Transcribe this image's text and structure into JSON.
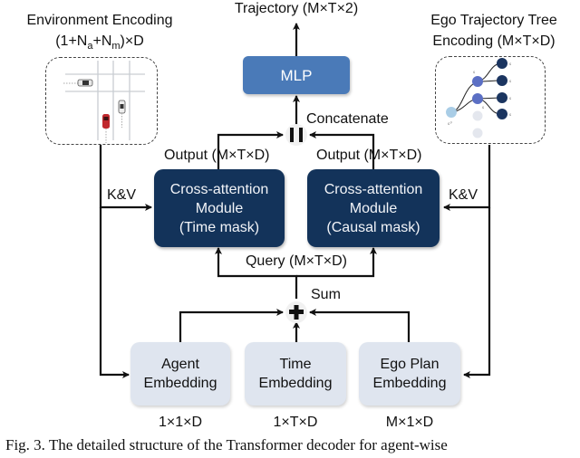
{
  "output": {
    "label": "Trajectory (M×T×2)"
  },
  "mlp": {
    "label": "MLP"
  },
  "concat": {
    "label": "Concatenate",
    "symbol_name": "concatenate-operator"
  },
  "environment_encoding": {
    "title_line1": "Environment Encoding",
    "title_line2_prefix": "(1+N",
    "sub_a": "a",
    "mid": "+N",
    "sub_m": "m",
    "title_line2_suffix": ")×D"
  },
  "ego_tree_encoding": {
    "title_line1": "Ego Trajectory Tree",
    "title_line2": "Encoding (M×T×D)"
  },
  "left_module": {
    "output_label": "Output (M×T×D)",
    "lines": [
      "Cross-attention",
      "Module",
      "(Time mask)"
    ],
    "kv_label": "K&V"
  },
  "right_module": {
    "output_label": "Output (M×T×D)",
    "lines": [
      "Cross-attention",
      "Module",
      "(Causal mask)"
    ],
    "kv_label": "K&V"
  },
  "query": {
    "label": "Query (M×T×D)"
  },
  "sum": {
    "label": "Sum"
  },
  "embeddings": [
    {
      "lines": [
        "Agent",
        "Embedding"
      ],
      "shape": "1×1×D"
    },
    {
      "lines": [
        "Time",
        "Embedding"
      ],
      "shape": "1×T×D"
    },
    {
      "lines": [
        "Ego Plan",
        "Embedding"
      ],
      "shape": "M×1×D"
    }
  ],
  "colors": {
    "mlp": "#4a7ab8",
    "cross_attention": "#13335a",
    "embedding": "#dfe5ef",
    "ego_car": "#c0282d",
    "tree_root": "#a9cde6",
    "tree_mid": "#5b6fc4",
    "tree_leaf": "#1b3560",
    "tree_faded": "#e4e7ee"
  },
  "caption": "Fig. 3.    The detailed structure of the Transformer decoder for agent-wise"
}
